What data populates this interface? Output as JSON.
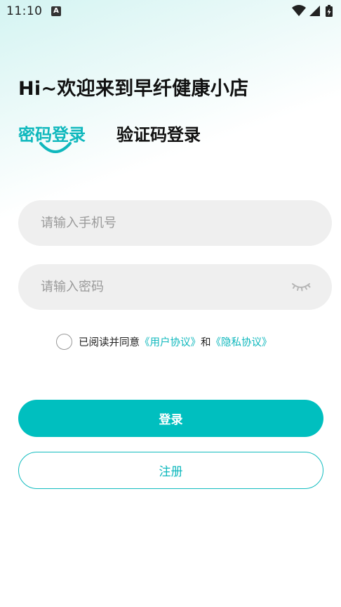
{
  "status_bar": {
    "time": "11:10",
    "notification_icon": "A",
    "icons": [
      "wifi-icon",
      "signal-icon",
      "battery-charging-icon"
    ]
  },
  "welcome_title": "Hi~欢迎来到早纤健康小店",
  "tabs": [
    {
      "label": "密码登录",
      "active": true
    },
    {
      "label": "验证码登录",
      "active": false
    }
  ],
  "phone_input": {
    "placeholder": "请输入手机号",
    "value": ""
  },
  "password_input": {
    "placeholder": "请输入密码",
    "value": "",
    "toggle_icon": "eye-closed-icon"
  },
  "agreement": {
    "checked": false,
    "prefix": "已阅读并同意",
    "user_agreement": "《用户协议》",
    "conjunction": "和",
    "privacy_policy": "《隐私协议》"
  },
  "buttons": {
    "login": "登录",
    "register": "注册"
  },
  "colors": {
    "accent": "#00bfbf",
    "input_bg": "#efefef",
    "text_dark": "#111111",
    "placeholder": "#9a9a9a"
  }
}
